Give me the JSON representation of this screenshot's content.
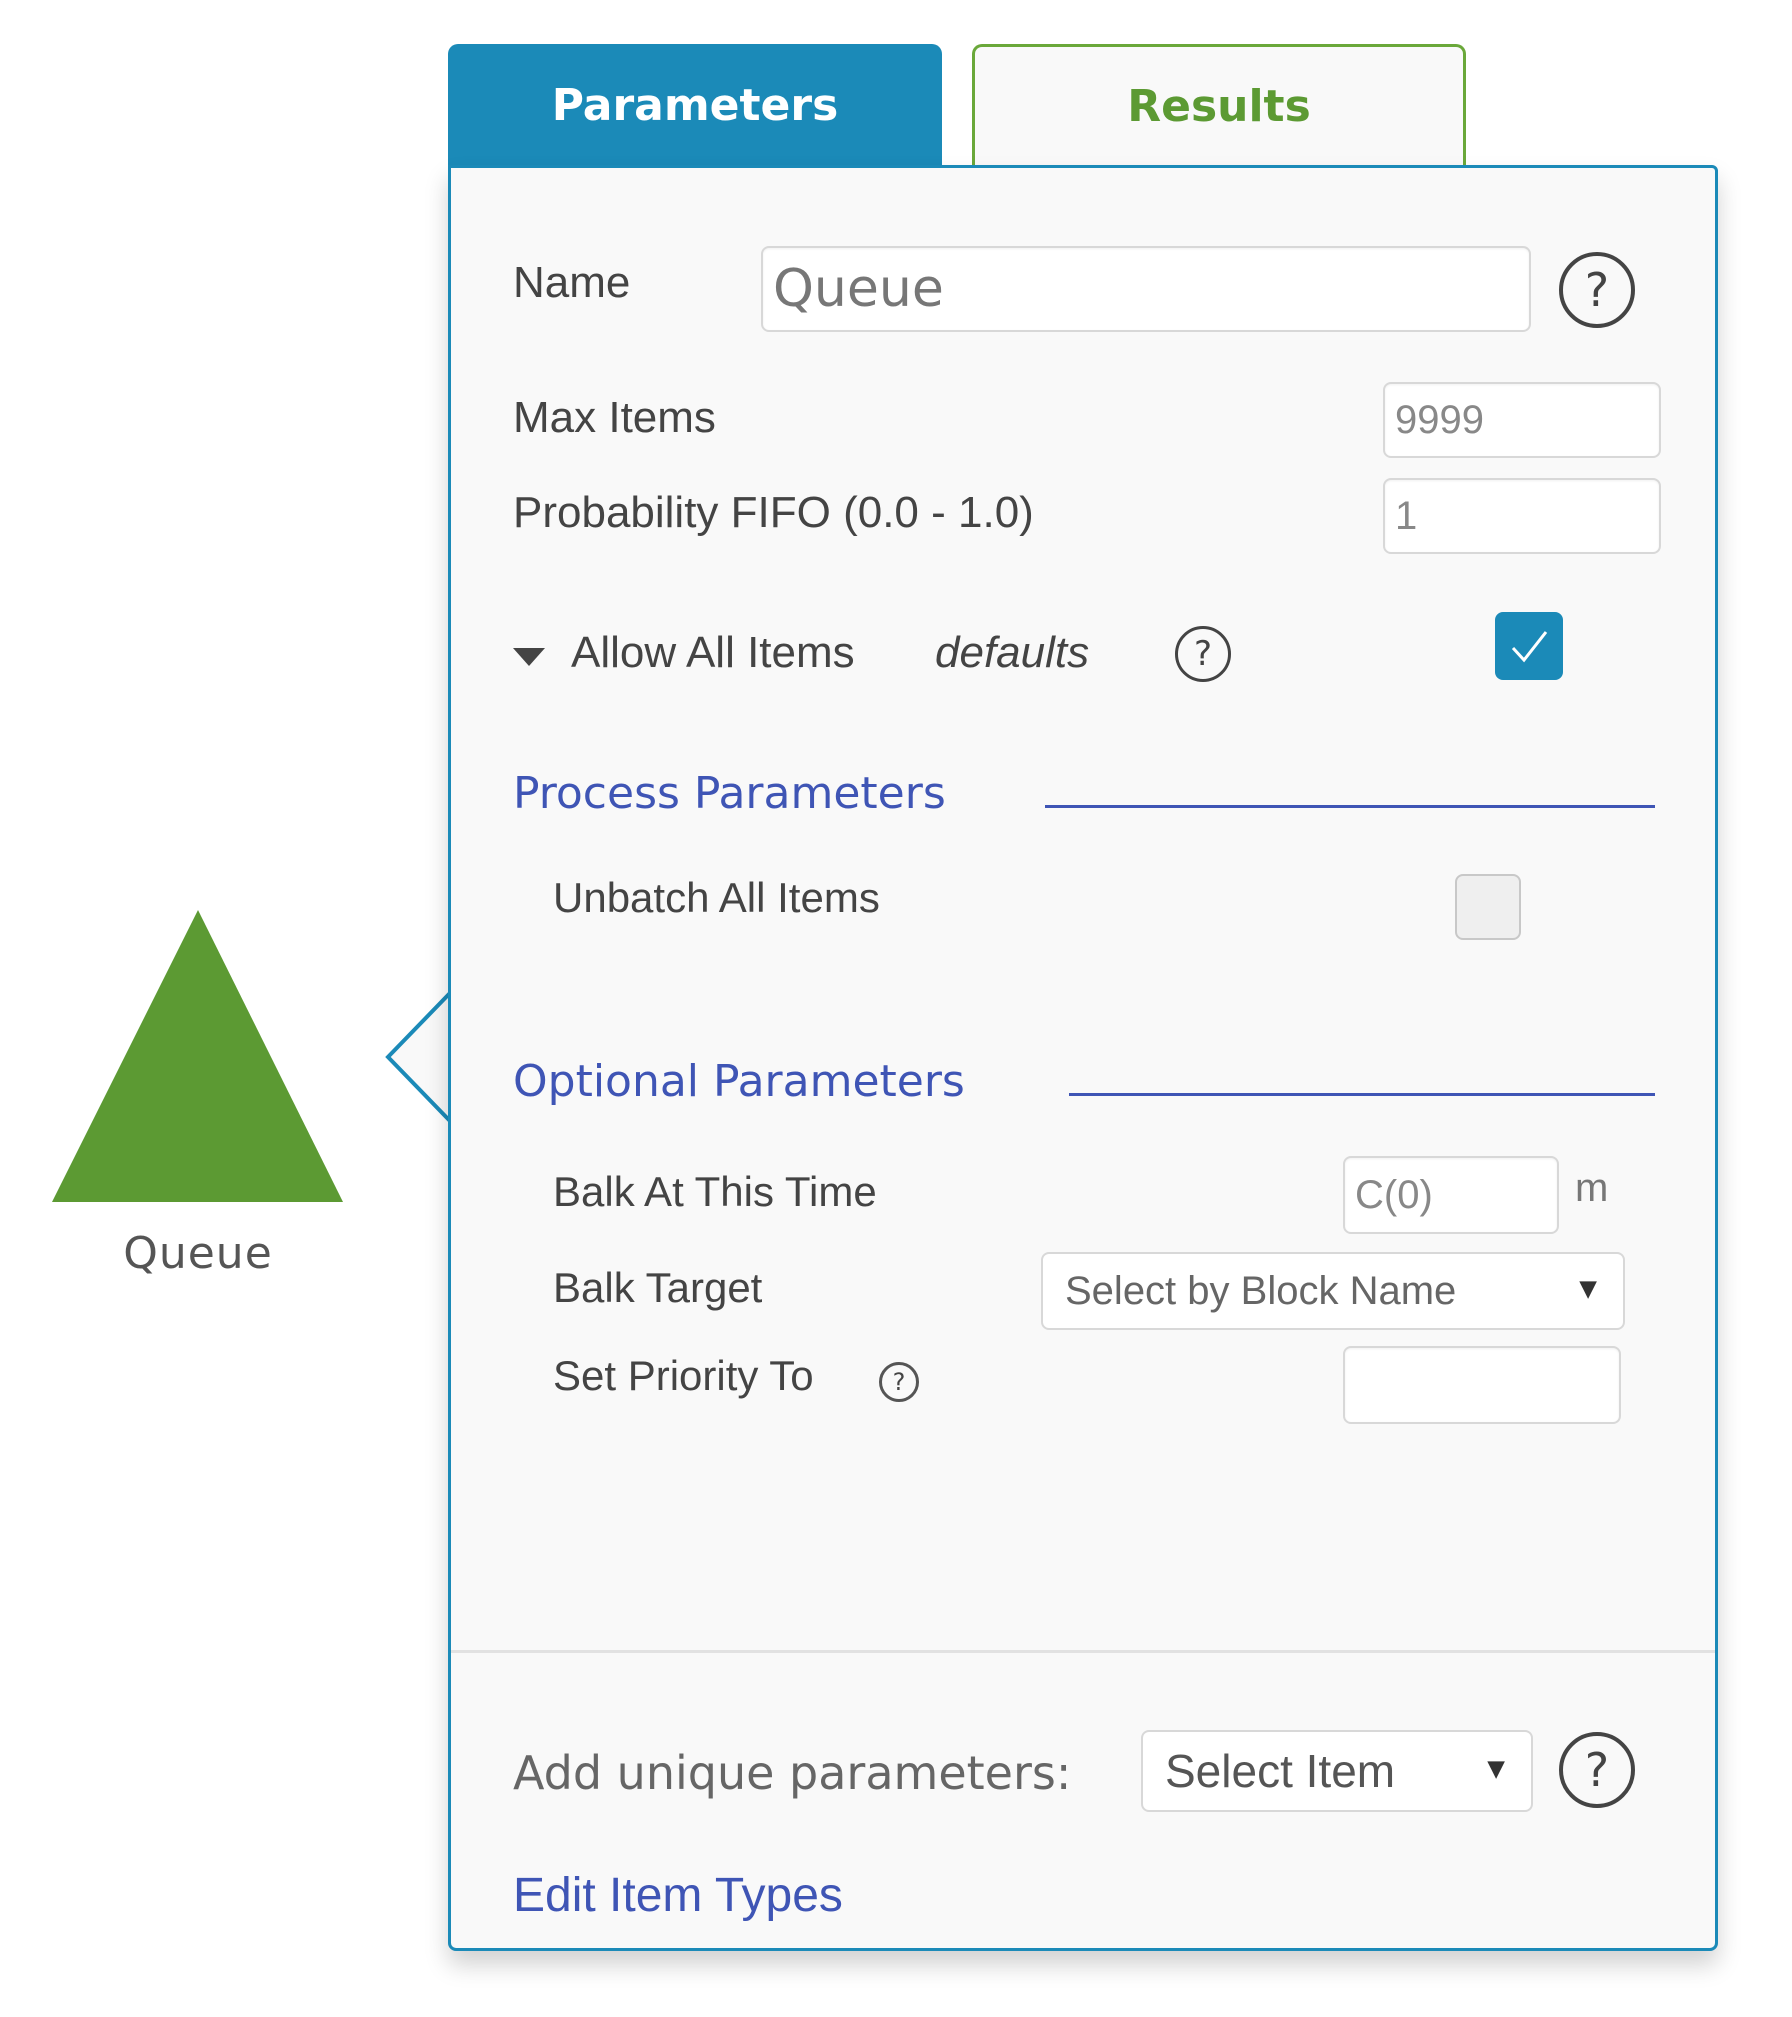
{
  "canvas": {
    "block": {
      "label": "Queue",
      "shape": "triangle",
      "color": "#5c9a33"
    }
  },
  "tabs": [
    {
      "label": "Parameters",
      "active": true,
      "color": "#1b8ab8"
    },
    {
      "label": "Results",
      "active": false,
      "color": "#5c9a33"
    }
  ],
  "panel": {
    "name": {
      "label": "Name",
      "value": "Queue",
      "help_icon": "question-circle-icon"
    },
    "max_items": {
      "label": "Max Items",
      "value": "9999"
    },
    "probability_fifo": {
      "label": "Probability FIFO (0.0 - 1.0)",
      "value": "1"
    },
    "allow_all_items": {
      "label": "Allow All Items",
      "hint": "defaults",
      "checked": true,
      "expand_icon": "caret-down-icon",
      "help_icon": "question-circle-icon"
    },
    "process_parameters": {
      "title": "Process Parameters",
      "unbatch_all_items": {
        "label": "Unbatch All Items",
        "checked": false
      }
    },
    "optional_parameters": {
      "title": "Optional Parameters",
      "balk_at_this_time": {
        "label": "Balk At This Time",
        "value": "C(0)",
        "unit": "m"
      },
      "balk_target": {
        "label": "Balk Target",
        "selected": "Select by Block Name",
        "arrow": "▼"
      },
      "set_priority_to": {
        "label": "Set Priority To",
        "value": "",
        "help_icon": "question-circle-icon"
      }
    },
    "footer": {
      "add_unique_label": "Add unique parameters:",
      "add_unique_select": "Select Item",
      "add_unique_arrow": "▼",
      "edit_item_types": "Edit Item Types"
    },
    "help_glyph": "?",
    "accent_color": "#1b8ab8",
    "section_color": "#3f55b5"
  }
}
